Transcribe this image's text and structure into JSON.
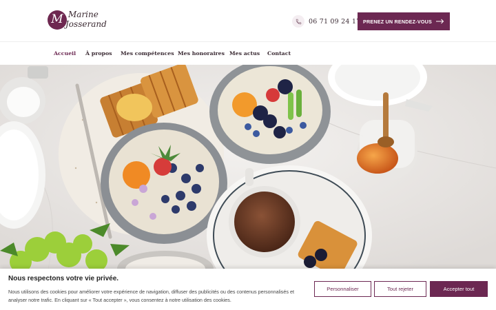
{
  "brand": {
    "monogram": "M",
    "name_line1": "Marine",
    "name_line2": "Josserand",
    "accent": "#6c2852"
  },
  "header": {
    "phone_icon": "phone-icon",
    "phone": "06 71 09 24 17",
    "cta_label": "PRENEZ UN RENDEZ-VOUS",
    "cta_icon": "arrow-right-icon"
  },
  "nav": {
    "items": [
      {
        "label": "Accueil",
        "active": true
      },
      {
        "label": "À propos"
      },
      {
        "label": "Mes compétences"
      },
      {
        "label": "Mes honoraires"
      },
      {
        "label": "Mes actus"
      },
      {
        "label": "Contact"
      }
    ]
  },
  "hero": {
    "image": "breakfast-table-photo"
  },
  "cookie_banner": {
    "title": "Nous respectons votre vie privée.",
    "text": "Nous utilisons des cookies pour améliorer votre expérience de navigation, diffuser des publicités ou des contenus personnalisés et analyser notre trafic. En cliquant sur « Tout accepter », vous consentez à notre utilisation des cookies.",
    "buttons": {
      "customize": "Personnaliser",
      "reject": "Tout rejeter",
      "accept": "Accepter tout"
    }
  }
}
